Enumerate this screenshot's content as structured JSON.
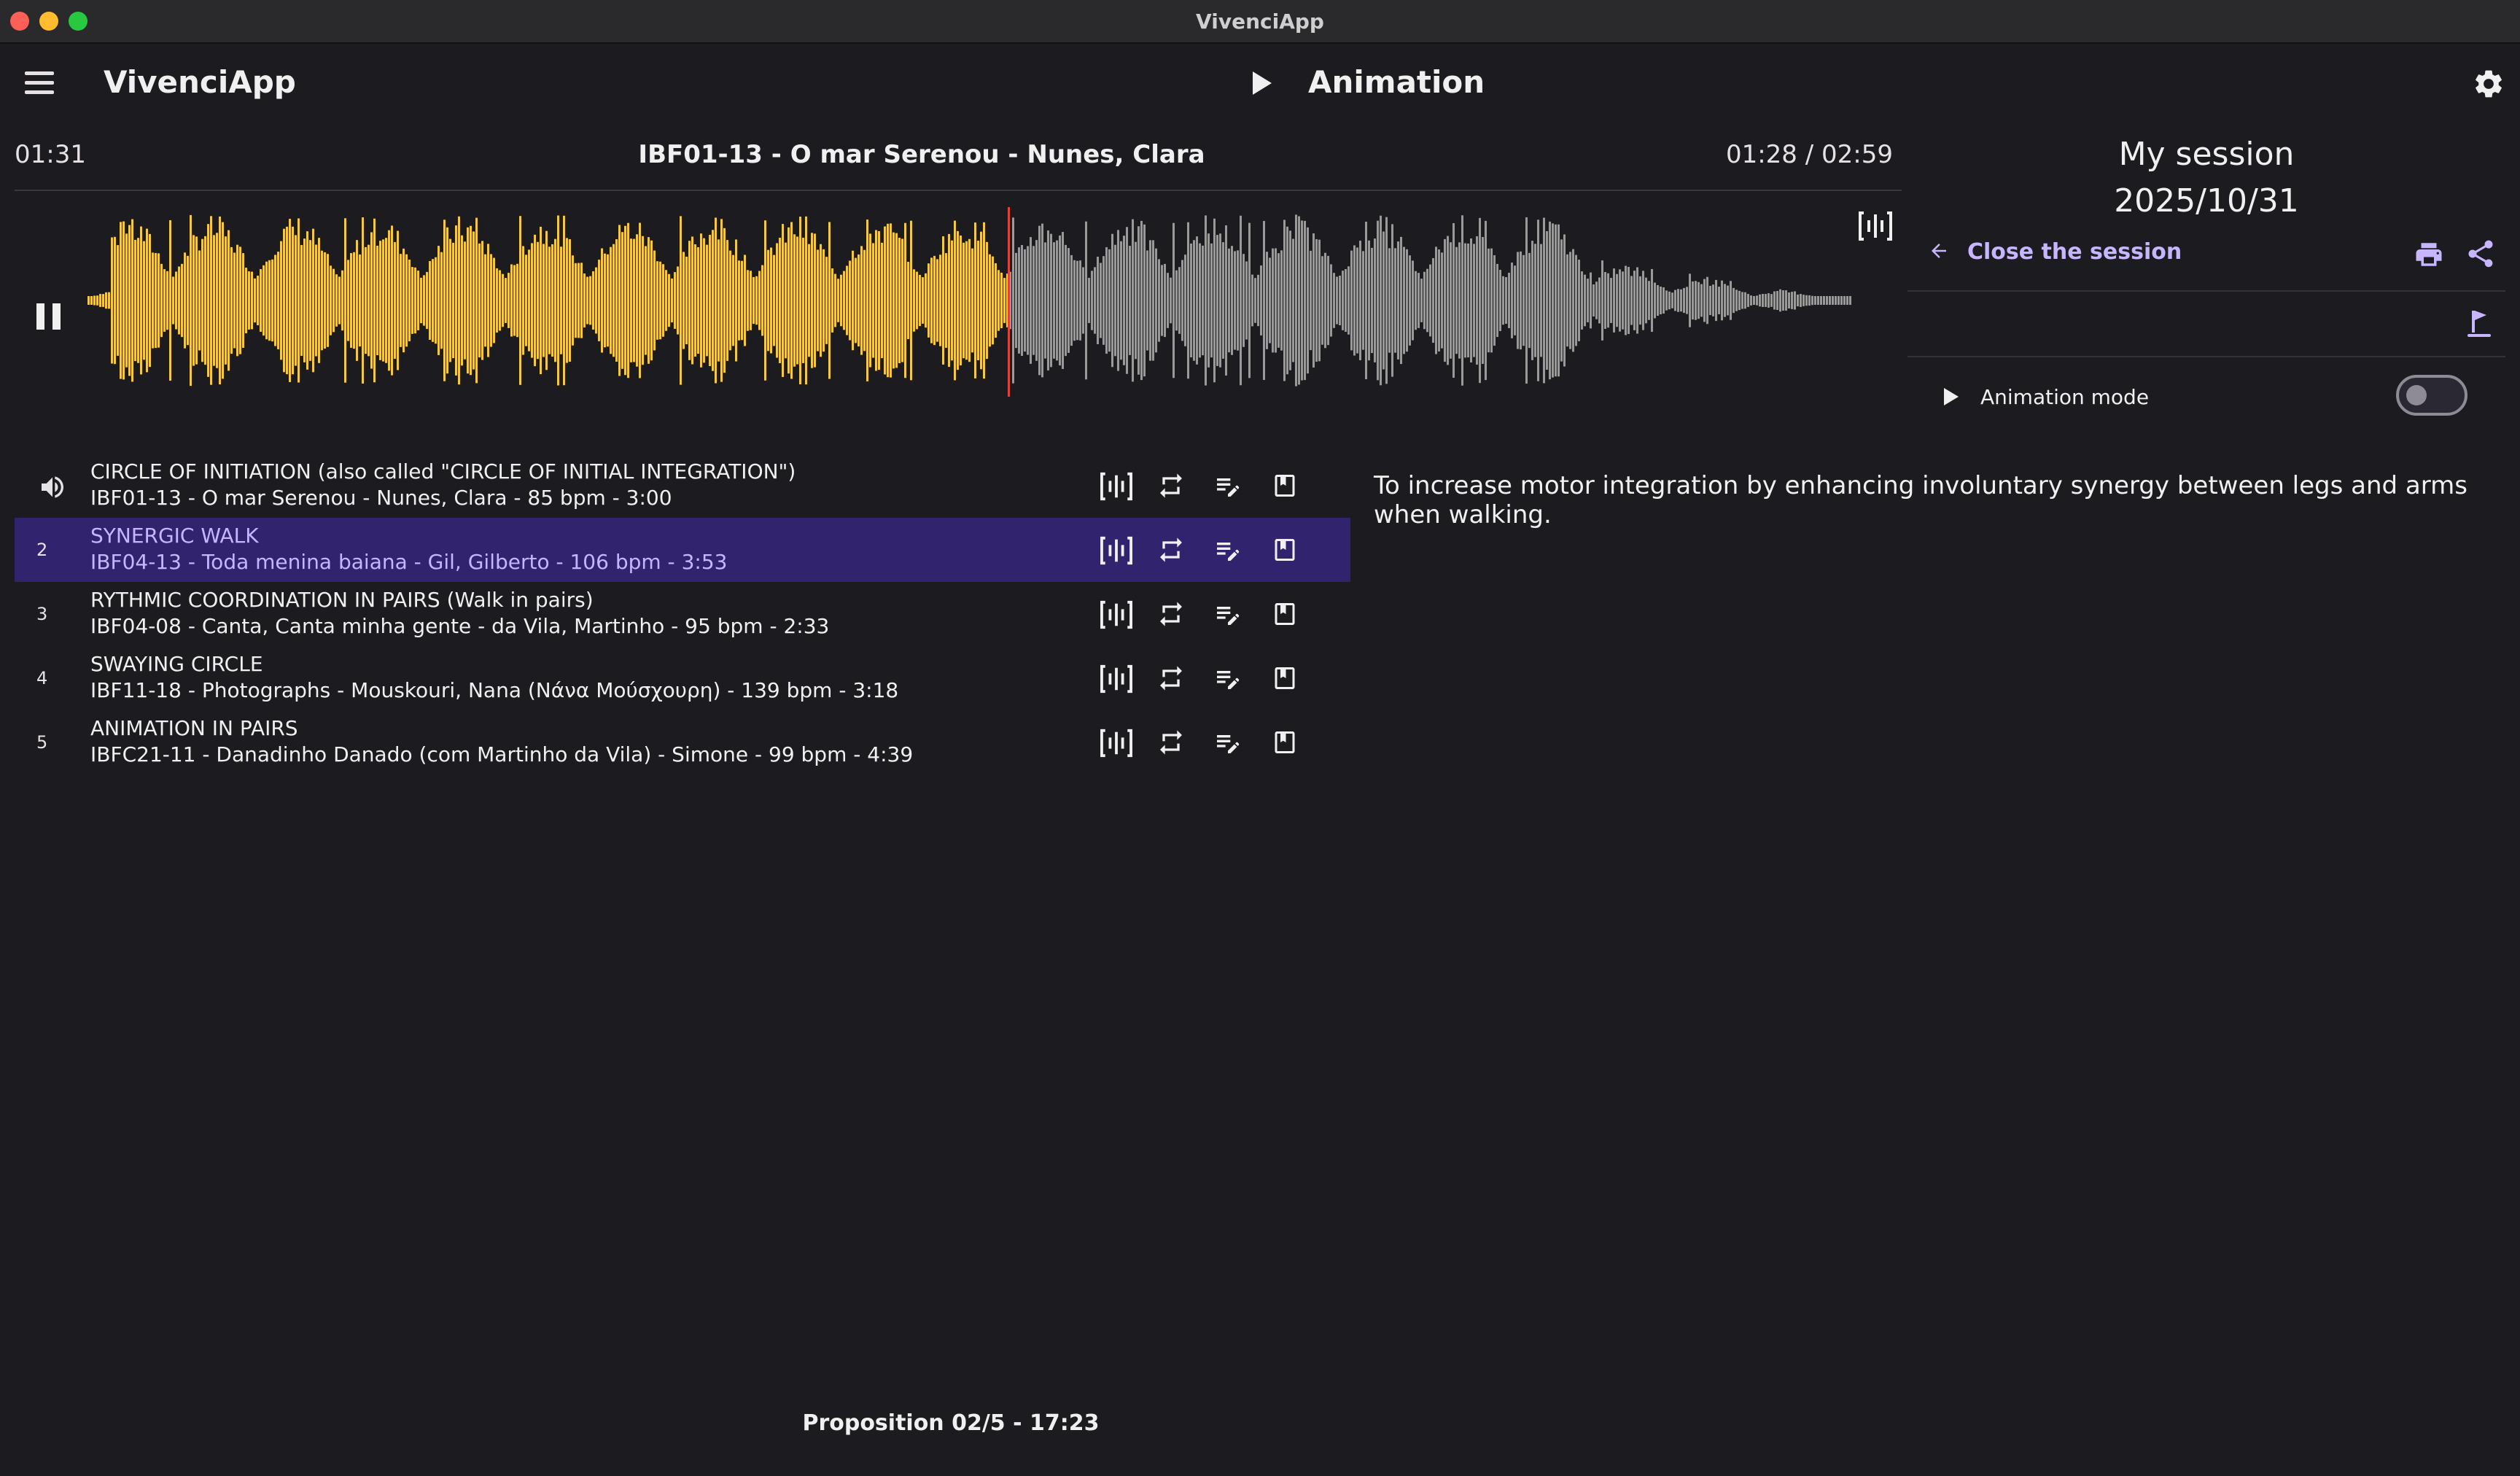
{
  "window": {
    "title": "VivenciApp"
  },
  "appbar": {
    "app_name": "VivenciApp",
    "mode_title": "Animation",
    "icons": {
      "menu": "menu-icon",
      "play": "play-icon",
      "settings": "gear-icon"
    }
  },
  "player": {
    "elapsed": "01:31",
    "track_title": "IBF01-13 - O mar Serenou - Nunes, Clara",
    "position": "01:28 / 02:59",
    "progress": 0.49,
    "played_color": "#f5c842",
    "remaining_color": "#9a9a9a",
    "cursor_color": "#e0413a",
    "icons": {
      "pause": "pause-icon",
      "waveform": "waveform-icon"
    }
  },
  "session": {
    "title": "My session",
    "date": "2025/10/31",
    "close_label": "Close the session",
    "animation_mode_label": "Animation mode",
    "animation_mode_on": false,
    "accent_color": "#c7b6ff",
    "icons": {
      "back": "arrow-left-icon",
      "print": "printer-icon",
      "share": "share-icon",
      "flag": "golf-flag-icon"
    }
  },
  "playlist": {
    "active_index": 1,
    "active_color": "#32236e",
    "items": [
      {
        "num": "",
        "name": "CIRCLE OF INITIATION (also called \"CIRCLE OF INITIAL INTEGRATION\")",
        "details": "IBF01-13 - O mar Serenou - Nunes, Clara - 85 bpm - 3:00",
        "playing": true
      },
      {
        "num": "2",
        "name": "SYNERGIC WALK",
        "details": "IBF04-13 - Toda menina baiana - Gil, Gilberto - 106 bpm - 3:53",
        "playing": false
      },
      {
        "num": "3",
        "name": "RYTHMIC COORDINATION IN PAIRS (Walk in pairs)",
        "details": "IBF04-08 - Canta, Canta minha gente - da Vila, Martinho - 95 bpm - 2:33",
        "playing": false
      },
      {
        "num": "4",
        "name": "SWAYING CIRCLE",
        "details": "IBF11-18 - Photographs - Mouskouri, Nana (Νάνα Μούσχουρη) - 139 bpm - 3:18",
        "playing": false
      },
      {
        "num": "5",
        "name": "ANIMATION IN PAIRS",
        "details": "IBFC21-11 - Danadinho Danado (com Martinho da Vila) - Simone - 99 bpm - 4:39",
        "playing": false
      }
    ],
    "row_icons": [
      "waveform-icon",
      "repeat-icon",
      "edit-notes-icon",
      "bookmark-icon"
    ]
  },
  "description": {
    "text": "To increase motor integration by enhancing involuntary synergy between legs and arms when walking."
  },
  "footer": {
    "text": "Proposition 02/5 - 17:23"
  }
}
